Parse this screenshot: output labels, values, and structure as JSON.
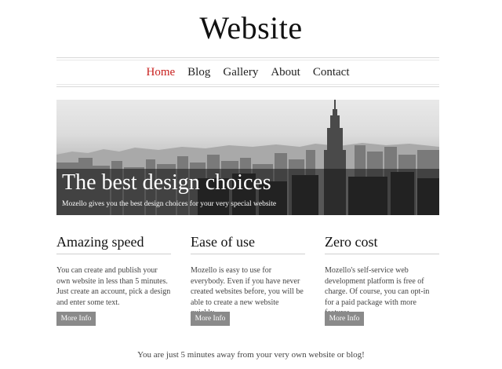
{
  "site": {
    "title": "Website"
  },
  "nav": {
    "items": [
      {
        "label": "Home",
        "active": true
      },
      {
        "label": "Blog",
        "active": false
      },
      {
        "label": "Gallery",
        "active": false
      },
      {
        "label": "About",
        "active": false
      },
      {
        "label": "Contact",
        "active": false
      }
    ],
    "active_color": "#c8201e"
  },
  "hero": {
    "title": "The best design choices",
    "subtitle": "Mozello gives you the best design choices for your very special website"
  },
  "features": [
    {
      "title": "Amazing speed",
      "text": "You can create and publish your own website in less than 5 minutes. Just create an account, pick a design and enter some text.",
      "button": "More Info"
    },
    {
      "title": "Ease of use",
      "text": "Mozello is easy to use for everybody. Even if you have never created websites before, you will be able to create a new website quickly.",
      "button": "More Info"
    },
    {
      "title": "Zero cost",
      "text": "Mozello's self-service web development platform is free of charge. Of course, you can opt-in for a paid package with more features.",
      "button": "More Info"
    }
  ],
  "footer": {
    "note": "You are just 5 minutes away from your very own website or blog!"
  }
}
